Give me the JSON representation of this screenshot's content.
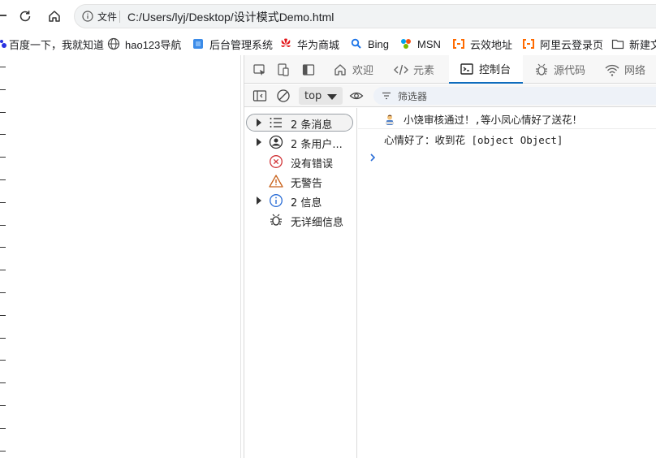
{
  "address_bar": {
    "file_label": "文件",
    "url": "C:/Users/lyj/Desktop/设计模式Demo.html"
  },
  "bookmarks": [
    {
      "label": "百度一下，我就知道",
      "icon": "baidu-icon"
    },
    {
      "label": "hao123导航",
      "icon": "globe-icon"
    },
    {
      "label": "后台管理系统",
      "icon": "cube-icon"
    },
    {
      "label": "华为商城",
      "icon": "huawei-icon"
    },
    {
      "label": "Bing",
      "icon": "search-icon"
    },
    {
      "label": "MSN",
      "icon": "msn-icon"
    },
    {
      "label": "云效地址",
      "icon": "bracket-icon"
    },
    {
      "label": "阿里云登录页",
      "icon": "bracket-icon"
    },
    {
      "label": "新建文",
      "icon": "folder-icon"
    }
  ],
  "devtools": {
    "tabs": [
      {
        "label": "欢迎",
        "icon": "home-icon"
      },
      {
        "label": "元素",
        "icon": "code-icon"
      },
      {
        "label": "控制台",
        "icon": "console-icon",
        "active": true
      },
      {
        "label": "源代码",
        "icon": "bug-icon"
      },
      {
        "label": "网络",
        "icon": "wifi-icon"
      }
    ],
    "toolbar": {
      "context": "top",
      "filter_placeholder": "筛选器"
    },
    "sidebar": [
      {
        "label": "2 条消息",
        "icon": "list-icon",
        "expandable": true,
        "selected": true
      },
      {
        "label": "2 条用户...",
        "icon": "user-icon",
        "expandable": true
      },
      {
        "label": "没有错误",
        "icon": "error-icon",
        "expandable": false
      },
      {
        "label": "无警告",
        "icon": "warning-icon",
        "expandable": false
      },
      {
        "label": "2 信息",
        "icon": "info-icon",
        "expandable": true
      },
      {
        "label": "无详细信息",
        "icon": "bug-icon",
        "expandable": false
      }
    ],
    "console_lines": [
      {
        "text": "小饶审核通过！,等小凤心情好了送花！",
        "emoji": "person-emoji"
      },
      {
        "text": "心情好了：收到花 [object Object]"
      }
    ]
  },
  "colors": {
    "accent": "#0f6cbd",
    "error": "#d13438",
    "warning": "#c8611a",
    "info": "#2a6dd6"
  }
}
